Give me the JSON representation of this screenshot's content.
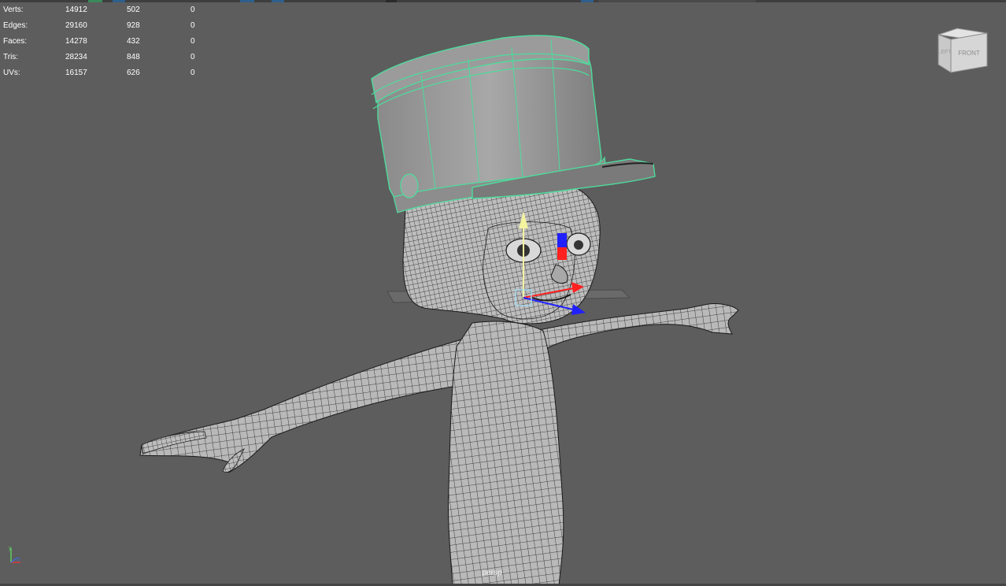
{
  "viewport": {
    "camera_name": "persp",
    "background_color": "#5d5d5d",
    "selection_color": "#4ddc9c",
    "wire_color": "#1e1e1e"
  },
  "hud": {
    "rows": [
      {
        "label": "Verts:",
        "total": "14912",
        "selected": "502",
        "extra": "0"
      },
      {
        "label": "Edges:",
        "total": "29160",
        "selected": "928",
        "extra": "0"
      },
      {
        "label": "Faces:",
        "total": "14278",
        "selected": "432",
        "extra": "0"
      },
      {
        "label": "Tris:",
        "total": "28234",
        "selected": "848",
        "extra": "0"
      },
      {
        "label": "UVs:",
        "total": "16157",
        "selected": "626",
        "extra": "0"
      }
    ]
  },
  "view_cube": {
    "left_face_label": "LEFT",
    "front_face_label": "FRONT"
  },
  "axis_gizmo": {
    "x_color": "#e23a3a",
    "y_color": "#5fd35f",
    "z_color": "#3a6fe2",
    "y_label": "y",
    "z_label": "z"
  },
  "manipulator": {
    "x_color": "#ff2020",
    "y_color": "#f3f3a0",
    "z_color": "#2020ff",
    "center_color": "#a6dcf0"
  }
}
